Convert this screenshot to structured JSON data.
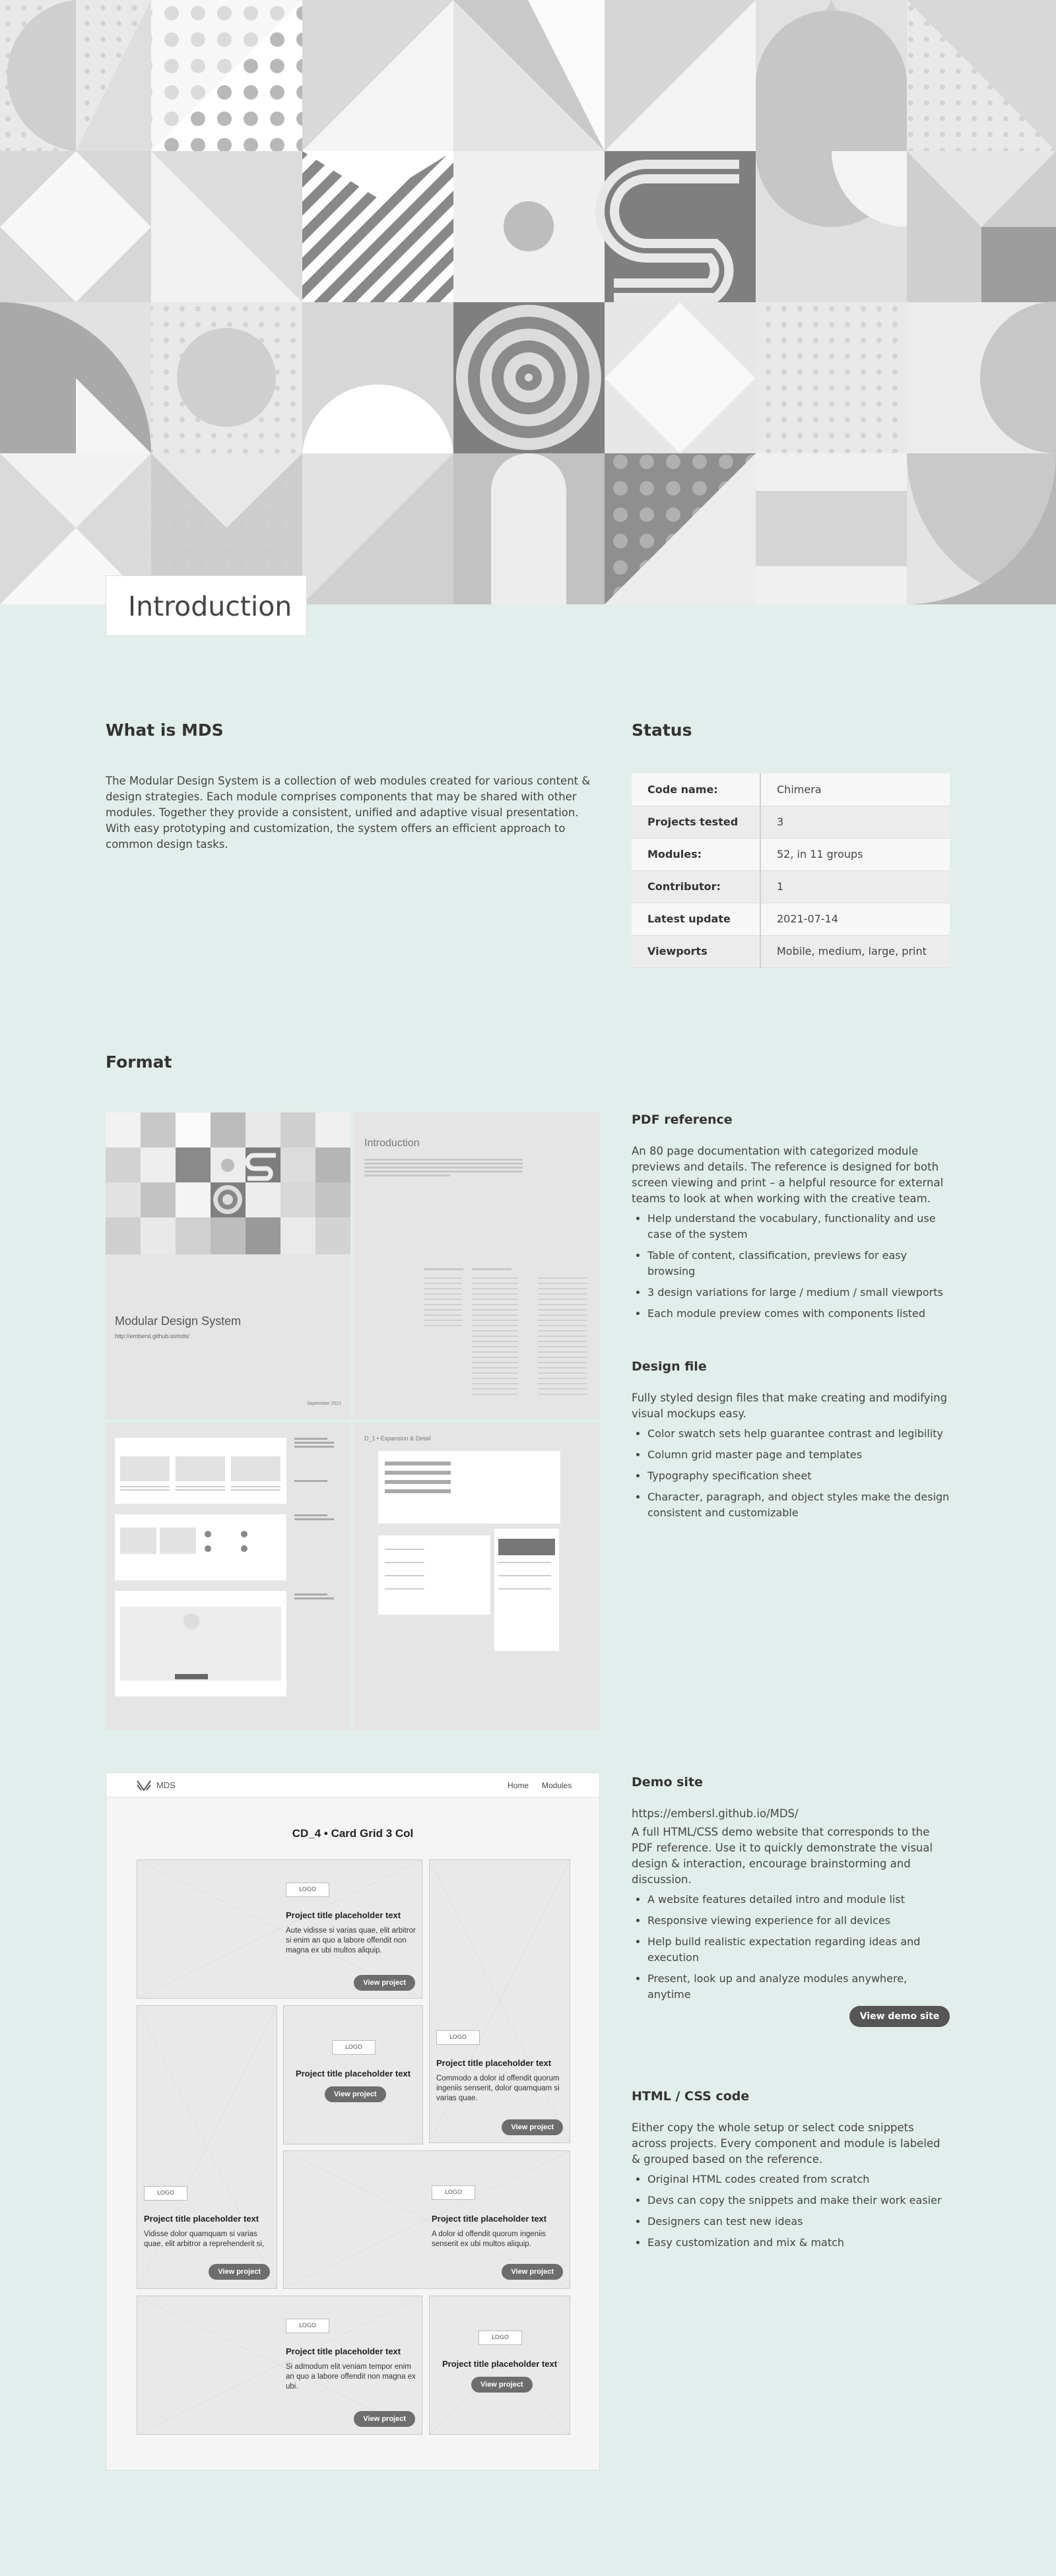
{
  "hero": {
    "tab_label": "Introduction"
  },
  "what": {
    "title": "What is MDS",
    "text": "The Modular Design System is a collection of web modules created for various content & design strategies. Each module comprises components that may be shared with other modules. Together they provide a consistent, unified and adaptive visual presentation. With easy prototyping and customization, the system offers an efficient approach to common design tasks."
  },
  "status": {
    "title": "Status",
    "rows": [
      {
        "key": "Code name:",
        "value": "Chimera"
      },
      {
        "key": "Projects tested",
        "value": "3"
      },
      {
        "key": "Modules:",
        "value": "52, in 11 groups"
      },
      {
        "key": "Contributor:",
        "value": "1"
      },
      {
        "key": "Latest update",
        "value": "2021-07-14"
      },
      {
        "key": "Viewports",
        "value": "Mobile, medium, large, print"
      }
    ]
  },
  "format": {
    "title": "Format",
    "pdf_thumb": {
      "cover_title": "Modular Design System",
      "cover_url": "http://embersl.github.io/mds/",
      "cover_date": "September 2021",
      "intro_title": "Introduction",
      "section_label": "D_1 • Expansion & Detail"
    },
    "pdf": {
      "title": "PDF reference",
      "text": "An 80 page documentation with categorized module previews and details. The reference is designed for both screen viewing and print – a helpful resource for external teams to look at when working with the creative team.",
      "items": [
        "Help understand the vocabulary, functionality and use case of the system",
        "Table of content, classification, previews for easy browsing",
        "3 design variations for large / medium / small viewports",
        "Each module preview comes with components listed"
      ]
    },
    "design": {
      "title": "Design file",
      "text": "Fully styled design files that make creating and modifying visual mockups easy.",
      "items": [
        "Color swatch sets help guarantee contrast and legibility",
        "Column grid master page and templates",
        "Typography specification sheet",
        "Character, paragraph, and object styles make the design consistent and customizable"
      ]
    },
    "demo": {
      "title": "Demo site",
      "url": "https://embersl.github.io/MDS/",
      "text": "A full HTML/CSS demo website that corresponds to the PDF reference. Use it to quickly demonstrate the visual design & interaction, encourage brainstorming and discussion.",
      "items": [
        "A website features detailed intro and module list",
        "Responsive viewing experience for all devices",
        "Help build realistic expectation regarding ideas and execution",
        "Present, look up and analyze modules anywhere, anytime"
      ],
      "button": "View demo site"
    },
    "html": {
      "title": "HTML / CSS code",
      "text": "Either copy the whole setup or select code snippets across projects. Every component and module is labeled & grouped based on the reference.",
      "items": [
        "Original HTML codes created from scratch",
        "Devs can copy the snippets and make their work easier",
        "Designers can test new ideas",
        "Easy customization and mix & match"
      ]
    }
  },
  "demo_preview": {
    "brand": "MDS",
    "nav": [
      "Home",
      "Modules"
    ],
    "heading": "CD_4 • Card Grid 3 Col",
    "logo": "LOGO",
    "card_title": "Project title placeholder text",
    "button": "View project",
    "desc": [
      "Aute vidisse si varias quae, elit arbitror si enim an quo a labore offendit non magna ex ubi multos aliquip.",
      "Commodo a dolor id offendit quorum ingeniis senserit, dolor quamquam si varias quae.",
      "Vidisse dolor quamquam si varias quae, elit arbitror a reprehenderit si,",
      "A dolor id offendit quorum ingeniis senserit ex ubi multos aliquip.",
      "Si admodum elit veniam tempor enim an quo a labore offendit non magna ex ubi."
    ]
  },
  "colors": {
    "page_bg": "#e2eeeb",
    "hero_bg": "#e9e9e9",
    "button_dark": "#555555"
  }
}
